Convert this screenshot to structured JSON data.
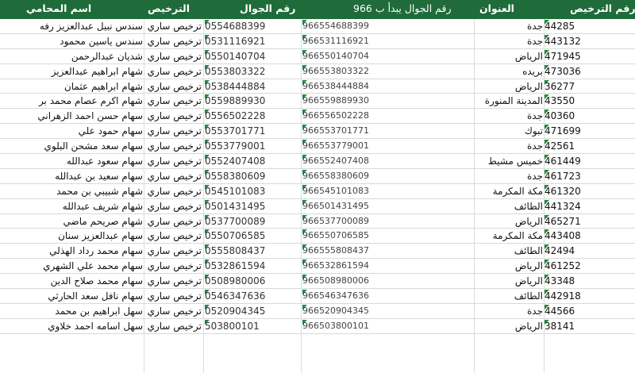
{
  "header": {
    "license_number": "رقم الترخيص",
    "address": "العنوان",
    "mobile_966": "رقم الجوال يبدأ ب 966",
    "mobile": "رقم الجوال",
    "license": "الترخيص",
    "lawyer_name": "اسم المحامي"
  },
  "rows": [
    {
      "name": "سندس نبيل عبدالعزيز رفه",
      "license": "ترخيص ساري",
      "mobile": "0554688399",
      "mobile966": "966554688399",
      "address": "جدة",
      "number": "44285"
    },
    {
      "name": "سندس ياسين محمود",
      "license": "ترخيص ساري",
      "mobile": "0531116921",
      "mobile966": "966531116921",
      "address": "جدة",
      "number": "443132"
    },
    {
      "name": "شديان عبدالرحمن",
      "license": "ترخيص ساري",
      "mobile": "0550140704",
      "mobile966": "966550140704",
      "address": "الرياض",
      "number": "471945"
    },
    {
      "name": "شهام ابراهيم عبدالعزيز",
      "license": "ترخيص ساري",
      "mobile": "0553803322",
      "mobile966": "966553803322",
      "address": "بريده",
      "number": "473036"
    },
    {
      "name": "شهام ابراهيم عثمان",
      "license": "ترخيص ساري",
      "mobile": "0538444884",
      "mobile966": "966538444884",
      "address": "الرياض",
      "number": "36277"
    },
    {
      "name": "شهام اكرم عصام محمد بر",
      "license": "ترخيص ساري",
      "mobile": "0559889930",
      "mobile966": "966559889930",
      "address": "المدينة المنورة",
      "number": "43550"
    },
    {
      "name": "سهام حسن احمد الزهراني",
      "license": "ترخيص ساري",
      "mobile": "0556502228",
      "mobile966": "966556502228",
      "address": "جدة",
      "number": "40360"
    },
    {
      "name": "سهام حمود علي",
      "license": "ترخيص ساري",
      "mobile": "0553701771",
      "mobile966": "966553701771",
      "address": "تبوك",
      "number": "471699"
    },
    {
      "name": "سهام سعد مشحن البلوي",
      "license": "ترخيص ساري",
      "mobile": "0553779001",
      "mobile966": "966553779001",
      "address": "جدة",
      "number": "42561"
    },
    {
      "name": "سهام سعود عبدالله",
      "license": "ترخيص ساري",
      "mobile": "0552407408",
      "mobile966": "966552407408",
      "address": "خميس مشيط",
      "number": "461449"
    },
    {
      "name": "سهام سعيد بن عبدالله",
      "license": "ترخيص ساري",
      "mobile": "0558380609",
      "mobile966": "966558380609",
      "address": "جدة",
      "number": "461723"
    },
    {
      "name": "شهام شبيبي بن محمد",
      "license": "ترخيص ساري",
      "mobile": "0545101083",
      "mobile966": "966545101083",
      "address": "مكة المكرمة",
      "number": "461320"
    },
    {
      "name": "شهام شريف عبدالله",
      "license": "ترخيص ساري",
      "mobile": "0501431495",
      "mobile966": "966501431495",
      "address": "الطائف",
      "number": "441324"
    },
    {
      "name": "شهام صريحم ماضي",
      "license": "ترخيص ساري",
      "mobile": "0537700089",
      "mobile966": "966537700089",
      "address": "الرياض",
      "number": "465271"
    },
    {
      "name": "سهام عبدالعزيز سنان",
      "license": "ترخيص ساري",
      "mobile": "0550706585",
      "mobile966": "966550706585",
      "address": "مكة المكرمة",
      "number": "443408"
    },
    {
      "name": "سهام محمد رداد الهذلي",
      "license": "ترخيص ساري",
      "mobile": "0555808437",
      "mobile966": "966555808437",
      "address": "الطائف",
      "number": "42494"
    },
    {
      "name": "سهام محمد علي الشهري",
      "license": "ترخيص ساري",
      "mobile": "0532861594",
      "mobile966": "966532861594",
      "address": "الرياض",
      "number": "461252"
    },
    {
      "name": "سهام محمد صلاح الدين",
      "license": "ترخيص ساري",
      "mobile": "0508980006",
      "mobile966": "966508980006",
      "address": "الرياض",
      "number": "43348"
    },
    {
      "name": "سهام نافل سعد الحارثي",
      "license": "ترخيص ساري",
      "mobile": "0546347636",
      "mobile966": "966546347636",
      "address": "الطائف",
      "number": "442918"
    },
    {
      "name": "سهل ابراهيم بن محمد",
      "license": "ترخيص ساري",
      "mobile": "0520904345",
      "mobile966": "966520904345",
      "address": "جدة",
      "number": "44566"
    },
    {
      "name": "سهل اسامه احمد خلاوي",
      "license": "ترخيص ساري",
      "mobile": "503800101",
      "mobile966": "966503800101",
      "address": "الرياض",
      "number": "38141"
    }
  ],
  "colors": {
    "header_bg": "#1f6b3a",
    "header_text": "#ffffff",
    "marker": "#1e8a3c"
  }
}
